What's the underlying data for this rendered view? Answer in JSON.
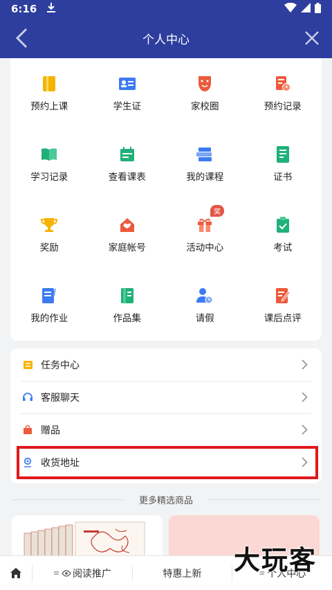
{
  "status": {
    "time": "6:16"
  },
  "nav": {
    "title": "个人中心"
  },
  "grid": [
    {
      "label": "预约上课",
      "icon": "book-icon"
    },
    {
      "label": "学生证",
      "icon": "id-card-icon"
    },
    {
      "label": "家校圈",
      "icon": "mask-icon"
    },
    {
      "label": "预约记录",
      "icon": "clock-doc-icon"
    },
    {
      "label": "学习记录",
      "icon": "open-book-icon"
    },
    {
      "label": "查看课表",
      "icon": "calendar-icon"
    },
    {
      "label": "我的课程",
      "icon": "books-stack-icon"
    },
    {
      "label": "证书",
      "icon": "certificate-icon"
    },
    {
      "label": "奖励",
      "icon": "trophy-icon"
    },
    {
      "label": "家庭帐号",
      "icon": "house-icon"
    },
    {
      "label": "活动中心",
      "icon": "gift-icon",
      "badge": "奖"
    },
    {
      "label": "考试",
      "icon": "clipboard-check-icon"
    },
    {
      "label": "我的作业",
      "icon": "homework-icon"
    },
    {
      "label": "作品集",
      "icon": "portfolio-icon"
    },
    {
      "label": "请假",
      "icon": "person-clock-icon"
    },
    {
      "label": "课后点评",
      "icon": "edit-doc-icon"
    }
  ],
  "list": [
    {
      "label": "任务中心",
      "icon": "task-icon"
    },
    {
      "label": "客服聊天",
      "icon": "headset-icon"
    },
    {
      "label": "赠品",
      "icon": "bag-icon"
    },
    {
      "label": "收货地址",
      "icon": "location-icon"
    }
  ],
  "section": {
    "title": "更多精选商品"
  },
  "tabs": {
    "read": "阅读推广",
    "sale": "特惠上新",
    "me": "个人中心"
  },
  "watermark": "大玩客",
  "colors": {
    "header": "#2d3e9e",
    "highlight": "#e0191c"
  }
}
